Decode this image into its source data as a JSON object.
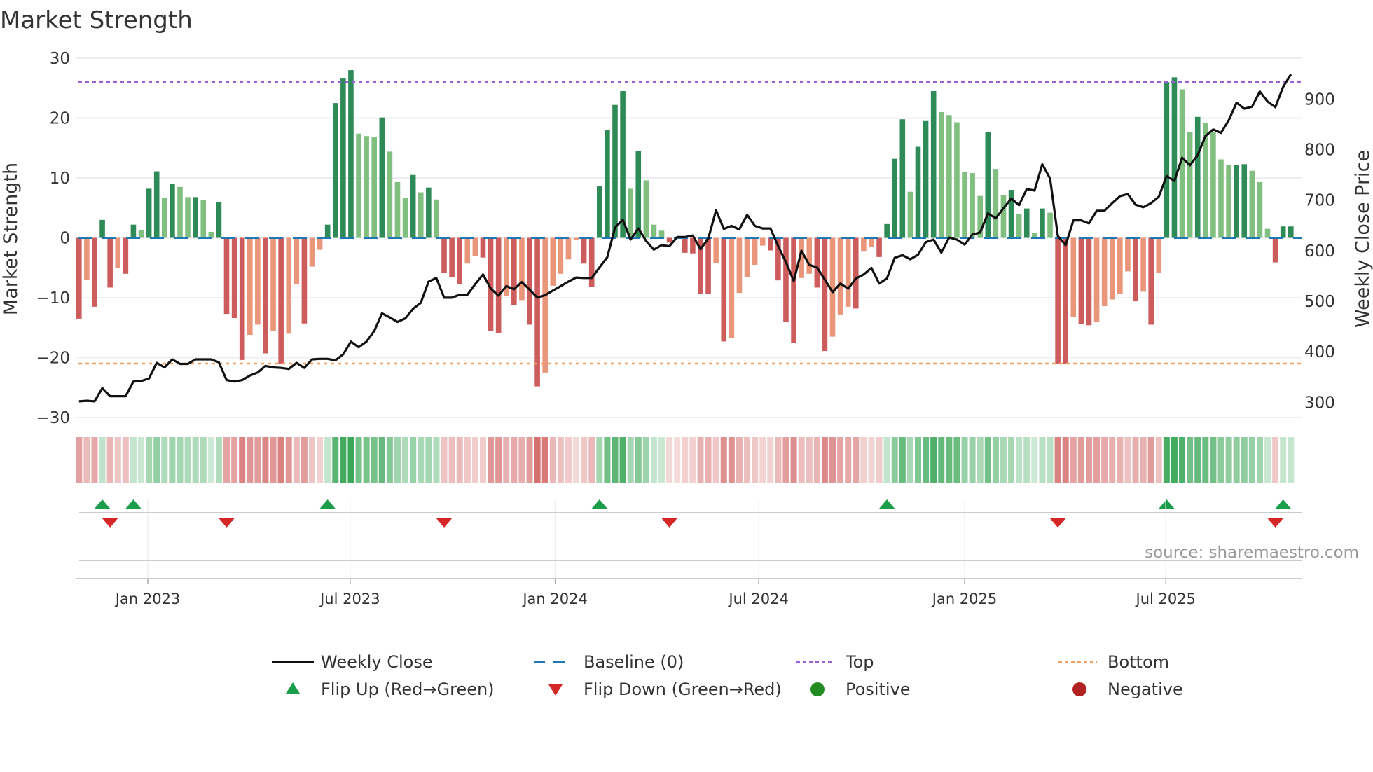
{
  "chart_data": {
    "type": "bar",
    "title": "Market Strength",
    "ylabel": "Market Strength",
    "y2label": "Weekly Close Price",
    "ylim": [
      -30,
      30
    ],
    "y2lim": [
      265,
      980
    ],
    "yticks": [
      30,
      20,
      10,
      0,
      -10,
      -20,
      -30
    ],
    "yticks_labels": [
      "30",
      "20",
      "10",
      "0",
      "−10",
      "−20",
      "−30"
    ],
    "y2ticks": [
      900,
      800,
      700,
      600,
      500,
      400,
      300
    ],
    "y2ticks_labels": [
      "900",
      "800",
      "700",
      "600",
      "500",
      "400",
      "300"
    ],
    "x_unit": "week index",
    "xlim": [
      0,
      156
    ],
    "xticks": [
      {
        "pos": 8.86,
        "label": "Jan 2023"
      },
      {
        "pos": 34.9,
        "label": "Jul 2023"
      },
      {
        "pos": 61.3,
        "label": "Jan 2024"
      },
      {
        "pos": 87.5,
        "label": "Jul 2024"
      },
      {
        "pos": 114.0,
        "label": "Jan 2025"
      },
      {
        "pos": 139.9,
        "label": "Jul 2025"
      }
    ],
    "top_level": 26,
    "bottom_level": -21,
    "baseline": 0,
    "strength": [
      -13.5,
      -7,
      -11.5,
      3,
      -8.3,
      -5,
      -6,
      2.2,
      1.3,
      8.2,
      11.1,
      6.7,
      9,
      8.5,
      6.8,
      6.8,
      6.3,
      1,
      6,
      -12.7,
      -13.4,
      -20.4,
      -16.2,
      -14.5,
      -19.3,
      -15.5,
      -21,
      -16,
      -7.7,
      -14.3,
      -4.8,
      -2,
      2.2,
      22.5,
      26.6,
      28,
      17.4,
      17,
      16.9,
      20.1,
      14.4,
      9.3,
      6.6,
      10.5,
      7.6,
      8.4,
      6.4,
      -5.8,
      -6.5,
      -7.7,
      -4.3,
      -3,
      -3.3,
      -15.5,
      -15.9,
      -9.7,
      -11.2,
      -10.4,
      -14.5,
      -24.8,
      -22.5,
      -8,
      -6,
      -3.6,
      -0.3,
      -4.3,
      -8.2,
      8.7,
      18,
      22.2,
      24.5,
      8.2,
      14.5,
      9.6,
      2.2,
      1.2,
      -0.8,
      -0.1,
      -2.5,
      -2.6,
      -9.4,
      -9.4,
      -4.2,
      -17.3,
      -16.7,
      -9.2,
      -6.5,
      -4.5,
      -1.3,
      -2.1,
      -7.1,
      -14.1,
      -17.5,
      -6.7,
      -6,
      -8.3,
      -18.9,
      -16.5,
      -12.8,
      -11.5,
      -11.8,
      -2.3,
      -1.5,
      -3.2,
      2.3,
      13.2,
      19.8,
      7.7,
      15.2,
      19.5,
      24.5,
      21,
      20.5,
      19.3,
      11,
      10.8,
      7,
      17.7,
      11.5,
      7.2,
      8,
      4,
      4.9,
      0.8,
      4.9,
      4.2,
      -21,
      -21,
      -13.2,
      -14.4,
      -14.6,
      -14.1,
      -11.4,
      -10.3,
      -9.4,
      -5.6,
      -10.6,
      -9,
      -14.5,
      -5.8,
      26,
      26.8,
      24.8,
      17.7,
      20.2,
      19.2,
      17.7,
      13.1,
      12.2,
      12.2,
      12.3,
      11.2,
      9.3,
      1.5,
      -4.1,
      1.9,
      1.9
    ],
    "weekly_close": [
      302,
      303,
      302,
      328,
      312,
      312,
      312,
      341,
      342,
      347,
      378,
      369,
      385,
      376,
      376,
      385,
      385,
      385,
      379,
      344,
      341,
      344,
      353,
      359,
      372,
      369,
      368,
      366,
      378,
      368,
      385,
      386,
      386,
      383,
      395,
      420,
      409,
      420,
      441,
      476,
      468,
      459,
      466,
      485,
      497,
      539,
      546,
      507,
      507,
      513,
      513,
      534,
      553,
      525,
      511,
      530,
      524,
      538,
      523,
      507,
      512,
      521,
      530,
      539,
      547,
      546,
      546,
      567,
      587,
      646,
      661,
      622,
      644,
      619,
      602,
      611,
      609,
      627,
      627,
      630,
      603,
      624,
      680,
      643,
      649,
      642,
      671,
      649,
      644,
      644,
      609,
      577,
      540,
      600,
      572,
      567,
      543,
      518,
      535,
      525,
      545,
      553,
      566,
      535,
      545,
      586,
      591,
      583,
      592,
      617,
      622,
      596,
      626,
      622,
      612,
      632,
      636,
      674,
      664,
      684,
      703,
      690,
      722,
      719,
      771,
      743,
      629,
      611,
      660,
      660,
      654,
      679,
      679,
      694,
      708,
      712,
      691,
      686,
      694,
      707,
      748,
      738,
      784,
      769,
      789,
      827,
      840,
      833,
      858,
      893,
      881,
      885,
      915,
      895,
      884,
      924,
      949
    ],
    "flip_up_weeks": [
      3,
      7,
      32,
      67,
      104,
      140,
      155
    ],
    "flip_down_weeks": [
      4,
      19,
      47,
      76,
      126,
      154
    ],
    "legend_placement": "bottom-center",
    "colors": {
      "pos_strong": "#2e8b57",
      "pos_weak": "#80bf80",
      "neg_strong": "#cd5c5c",
      "neg_weak": "#e9967a",
      "line": "#111111",
      "baseline": "#1f77b4",
      "top": "#9b5fd6",
      "bottom": "#f0a060",
      "flip_up": "#1a9e4a",
      "flip_down": "#d62728",
      "positive": "#228b22",
      "negative": "#b22222"
    }
  },
  "legend": {
    "weekly_close": "Weekly Close",
    "baseline": "Baseline (0)",
    "top": "Top",
    "bottom": "Bottom",
    "flip_up": "Flip Up (Red→Green)",
    "flip_down": "Flip Down (Green→Red)",
    "positive": "Positive",
    "negative": "Negative"
  },
  "source": "source: sharemaestro.com"
}
